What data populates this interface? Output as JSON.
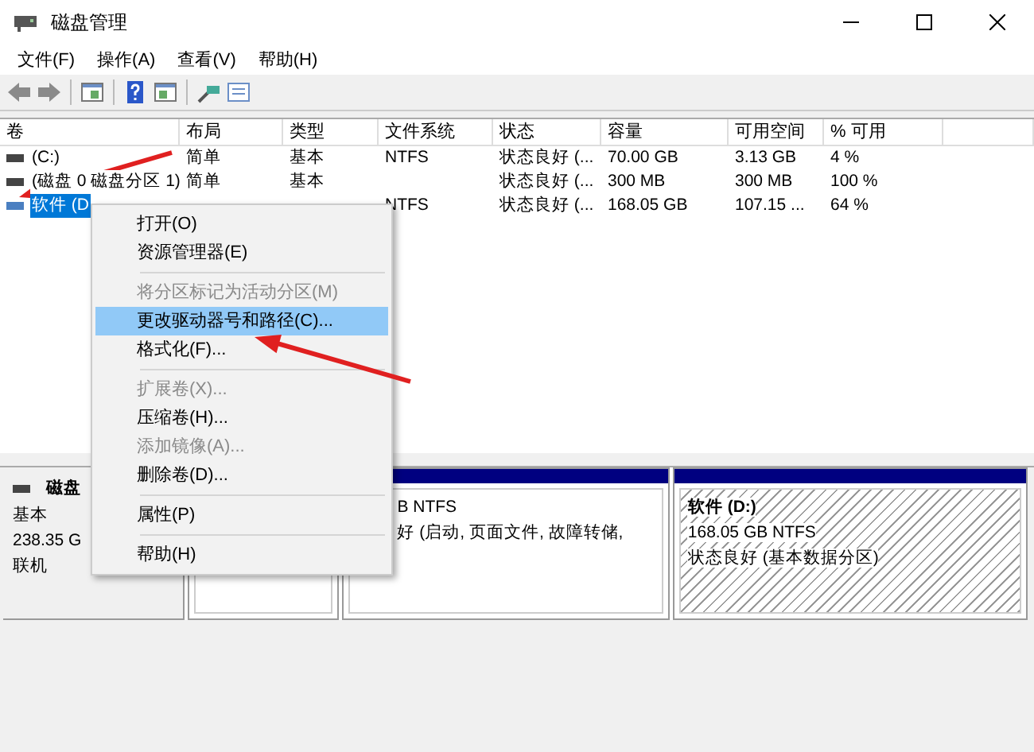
{
  "window": {
    "title": "磁盘管理"
  },
  "menu_bar": [
    "文件(F)",
    "操作(A)",
    "查看(V)",
    "帮助(H)"
  ],
  "table": {
    "columns": [
      "卷",
      "布局",
      "类型",
      "文件系统",
      "状态",
      "容量",
      "可用空间",
      "% 可用"
    ],
    "rows": [
      {
        "selected": false,
        "cells": [
          "(C:)",
          "简单",
          "基本",
          "NTFS",
          "状态良好 (...",
          "70.00 GB",
          "3.13 GB",
          "4 %"
        ]
      },
      {
        "selected": false,
        "cells": [
          "(磁盘 0 磁盘分区 1)",
          "简单",
          "基本",
          "",
          "状态良好 (...",
          "300 MB",
          "300 MB",
          "100 %"
        ]
      },
      {
        "selected": true,
        "cells": [
          "软件 (D",
          "",
          "",
          "NTFS",
          "状态良好 (...",
          "168.05 GB",
          "107.15 ...",
          "64 %"
        ]
      }
    ]
  },
  "context_menu": [
    {
      "kind": "item",
      "label": "打开(O)",
      "disabled": false,
      "selected": false
    },
    {
      "kind": "item",
      "label": "资源管理器(E)",
      "disabled": false,
      "selected": false
    },
    {
      "kind": "separator"
    },
    {
      "kind": "item",
      "label": "将分区标记为活动分区(M)",
      "disabled": true,
      "selected": false
    },
    {
      "kind": "item",
      "label": "更改驱动器号和路径(C)...",
      "disabled": false,
      "selected": true
    },
    {
      "kind": "item",
      "label": "格式化(F)...",
      "disabled": false,
      "selected": false
    },
    {
      "kind": "separator"
    },
    {
      "kind": "item",
      "label": "扩展卷(X)...",
      "disabled": true,
      "selected": false
    },
    {
      "kind": "item",
      "label": "压缩卷(H)...",
      "disabled": false,
      "selected": false
    },
    {
      "kind": "item",
      "label": "添加镜像(A)...",
      "disabled": true,
      "selected": false
    },
    {
      "kind": "item",
      "label": "删除卷(D)...",
      "disabled": false,
      "selected": false
    },
    {
      "kind": "separator"
    },
    {
      "kind": "item",
      "label": "属性(P)",
      "disabled": false,
      "selected": false
    },
    {
      "kind": "separator"
    },
    {
      "kind": "item",
      "label": "帮助(H)",
      "disabled": false,
      "selected": false
    }
  ],
  "disk": {
    "name": "磁盘",
    "type": "基本",
    "size": "238.35 G",
    "status": "联机",
    "partitions": [
      {
        "selected": false
      },
      {
        "selected": false,
        "lines": [
          "B NTFS",
          "好 (启动, 页面文件, 故障转储,"
        ]
      },
      {
        "selected": true,
        "title": "软件  (D:)",
        "lines": [
          "168.05 GB NTFS",
          "状态良好 (基本数据分区)"
        ]
      }
    ]
  }
}
